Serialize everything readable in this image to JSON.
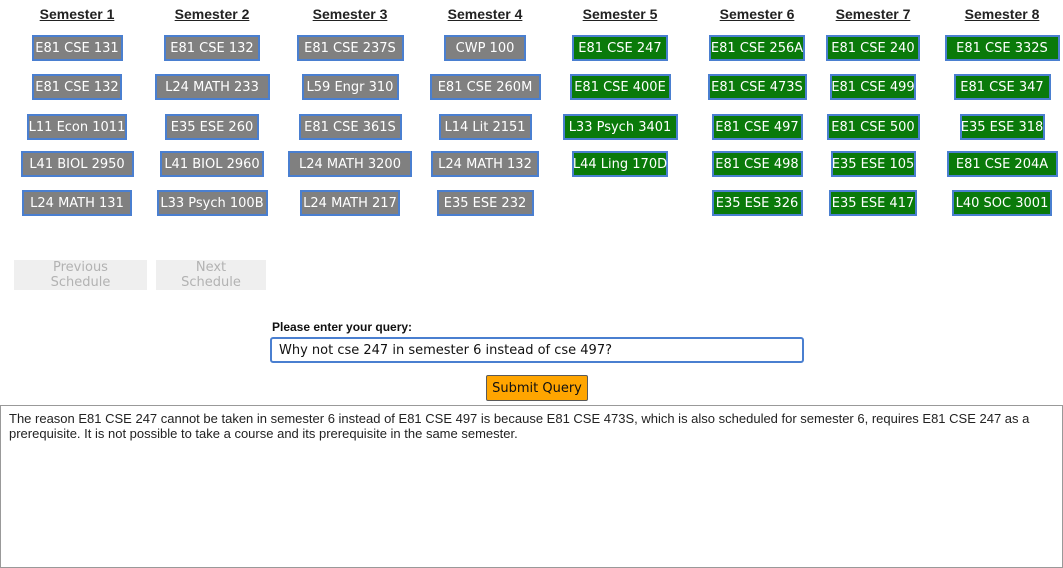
{
  "semesters": [
    {
      "title": "Semester 1",
      "courses": [
        "E81 CSE 131",
        "E81 CSE 132",
        "L11 Econ 1011",
        "L41 BIOL 2950",
        "L24 MATH 131"
      ]
    },
    {
      "title": "Semester 2",
      "courses": [
        "E81 CSE 132",
        "L24 MATH 233",
        "E35 ESE 260",
        "L41 BIOL 2960",
        "L33 Psych 100B"
      ]
    },
    {
      "title": "Semester 3",
      "courses": [
        "E81 CSE 237S",
        "L59 Engr 310",
        "E81 CSE 361S",
        "L24 MATH 3200",
        "L24 MATH 217"
      ]
    },
    {
      "title": "Semester 4",
      "courses": [
        "CWP 100",
        "E81 CSE 260M",
        "L14 Lit 2151",
        "L24 MATH 132",
        "E35 ESE 232"
      ]
    },
    {
      "title": "Semester 5",
      "courses": [
        "E81 CSE 247",
        "E81 CSE 400E",
        "L33 Psych 3401",
        "L44 Ling 170D"
      ]
    },
    {
      "title": "Semester 6",
      "courses": [
        "E81 CSE 256A",
        "E81 CSE 473S",
        "E81 CSE 497",
        "E81 CSE 498",
        "E35 ESE 326"
      ]
    },
    {
      "title": "Semester 7",
      "courses": [
        "E81 CSE 240",
        "E81 CSE 499",
        "E81 CSE 500",
        "E35 ESE 105",
        "E35 ESE 417"
      ]
    },
    {
      "title": "Semester 8",
      "courses": [
        "E81 CSE 332S",
        "E81 CSE 347",
        "E35 ESE 318",
        "E81 CSE 204A",
        "L40 SOC 3001"
      ]
    }
  ],
  "colors": {
    "taken": "#808080",
    "future": "#0a7a0a",
    "border": "#4a7fd0",
    "submit": "#ffa500"
  },
  "nav": {
    "previous_label": "Previous Schedule",
    "next_label": "Next Schedule"
  },
  "query": {
    "label": "Please enter your query:",
    "value": "Why not cse 247 in semester 6 instead of cse 497?",
    "submit_label": "Submit Query"
  },
  "response": "The reason E81 CSE 247 cannot be taken in semester 6 instead of E81 CSE 497 is because E81 CSE 473S, which is also scheduled for semester 6, requires E81 CSE 247 as a prerequisite. It is not possible to take a course and its prerequisite in the same semester."
}
